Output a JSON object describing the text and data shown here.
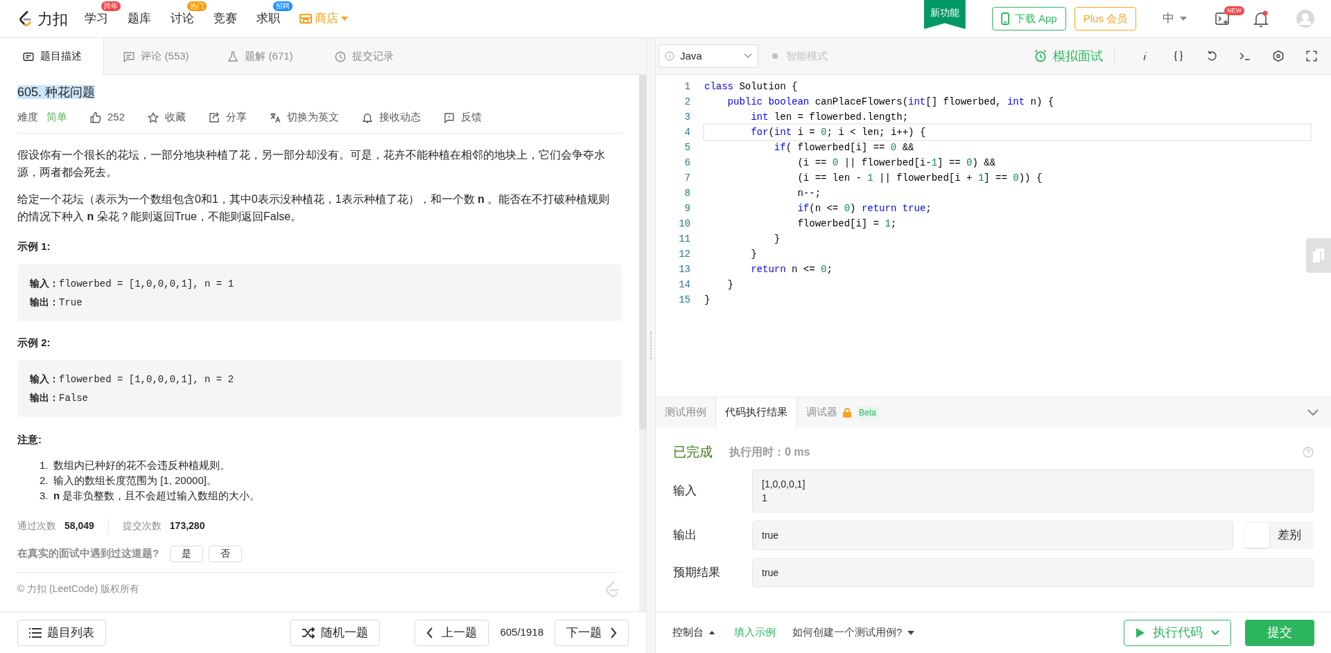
{
  "nav": {
    "logo": "力扣",
    "items": [
      {
        "label": "学习",
        "badge": "跨年",
        "color": "#f5474b"
      },
      {
        "label": "题库"
      },
      {
        "label": "讨论",
        "badge": "热门",
        "color": "#ff9a00"
      },
      {
        "label": "竞赛"
      },
      {
        "label": "求职",
        "badge": "招聘",
        "color": "#1a90ff"
      }
    ],
    "shop": "商店",
    "ribbon": "新功能",
    "download": "下载 App",
    "plus": "Plus 会员",
    "lang": "中",
    "new_badge": "NEW"
  },
  "tabs": [
    {
      "label": "题目描述",
      "selected": true
    },
    {
      "label": "评论 (553)",
      "selected": false
    },
    {
      "label": "题解 (671)",
      "selected": false
    },
    {
      "label": "提交记录",
      "selected": false
    }
  ],
  "editor_bar": {
    "language": "Java",
    "smart_mode": {
      "label": "智能模式",
      "on": false
    },
    "interview": "模拟面试"
  },
  "problem": {
    "title": "605. 种花问题",
    "difficulty_label": "难度",
    "difficulty": "简单",
    "likes": "252",
    "actions": [
      "收藏",
      "分享",
      "切换为英文",
      "接收动态",
      "反馈"
    ],
    "paragraphs": [
      "假设你有一个很长的花坛，一部分地块种植了花，另一部分却没有。可是，花卉不能种植在相邻的地块上，它们会争夺水源，两者都会死去。",
      "给定一个花坛（表示为一个数组包含0和1，其中0表示没种植花，1表示种植了花），和一个数 **n** 。能否在不打破种植规则的情况下种入 **n** 朵花？能则返回True，不能则返回False。"
    ],
    "examples": [
      {
        "heading": "示例 1:",
        "input_label": "输入：",
        "input": "flowerbed = [1,0,0,0,1], n = 1",
        "output_label": "输出：",
        "output": "True"
      },
      {
        "heading": "示例 2:",
        "input_label": "输入：",
        "input": "flowerbed = [1,0,0,0,1], n = 2",
        "output_label": "输出：",
        "output": "False"
      }
    ],
    "notes_heading": "注意:",
    "notes": [
      {
        "number": "1.",
        "text": "数组内已种好的花不会违反种植规则。"
      },
      {
        "number": "2.",
        "text": "输入的数组长度范围为 [1, 20000]。"
      },
      {
        "number": "3.",
        "text": "**n** 是非负整数，且不会超过输入数组的大小。"
      }
    ],
    "stats": [
      {
        "label": "通过次数",
        "value": "58,049"
      },
      {
        "label": "提交次数",
        "value": "173,280"
      }
    ],
    "interview_q": "在真实的面试中遇到过这道题?",
    "answers": [
      "是",
      "否"
    ],
    "copyright": "© 力扣 (LeetCode) 版权所有"
  },
  "left_footer": {
    "list": "题目列表",
    "random": "随机一题",
    "prev": "上一题",
    "position": "605/1918",
    "next": "下一题"
  },
  "code": [
    {
      "number": "1",
      "tokens": [
        {
          "kind": "keyword",
          "text": "class"
        },
        {
          "kind": "plain",
          "text": " Solution {"
        }
      ]
    },
    {
      "number": "2",
      "tokens": [
        {
          "kind": "keyword",
          "text": "    public"
        },
        {
          "kind": "keyword",
          "text": " boolean"
        },
        {
          "kind": "plain",
          "text": " canPlaceFlowers("
        },
        {
          "kind": "keyword",
          "text": "int"
        },
        {
          "kind": "plain",
          "text": "[] flowerbed, "
        },
        {
          "kind": "keyword",
          "text": "int"
        },
        {
          "kind": "plain",
          "text": " n) {"
        }
      ]
    },
    {
      "number": "3",
      "tokens": [
        {
          "kind": "keyword",
          "text": "        int"
        },
        {
          "kind": "plain",
          "text": " len = flowerbed.length;"
        }
      ]
    },
    {
      "number": "4",
      "current": true,
      "tokens": [
        {
          "kind": "keyword",
          "text": "        for"
        },
        {
          "kind": "plain",
          "text": "("
        },
        {
          "kind": "keyword",
          "text": "int"
        },
        {
          "kind": "plain",
          "text": " i = "
        },
        {
          "kind": "number",
          "text": "0"
        },
        {
          "kind": "plain",
          "text": "; i < len; i++) {"
        }
      ]
    },
    {
      "number": "5",
      "tokens": [
        {
          "kind": "keyword",
          "text": "            if"
        },
        {
          "kind": "plain",
          "text": "( flowerbed[i] == "
        },
        {
          "kind": "number",
          "text": "0"
        },
        {
          "kind": "plain",
          "text": " &&"
        }
      ]
    },
    {
      "number": "6",
      "tokens": [
        {
          "kind": "plain",
          "text": "                (i == "
        },
        {
          "kind": "number",
          "text": "0"
        },
        {
          "kind": "plain",
          "text": " || flowerbed[i-"
        },
        {
          "kind": "number",
          "text": "1"
        },
        {
          "kind": "plain",
          "text": "] == "
        },
        {
          "kind": "number",
          "text": "0"
        },
        {
          "kind": "plain",
          "text": ") &&"
        }
      ]
    },
    {
      "number": "7",
      "tokens": [
        {
          "kind": "plain",
          "text": "                (i == len - "
        },
        {
          "kind": "number",
          "text": "1"
        },
        {
          "kind": "plain",
          "text": " || flowerbed[i + "
        },
        {
          "kind": "number",
          "text": "1"
        },
        {
          "kind": "plain",
          "text": "] == "
        },
        {
          "kind": "number",
          "text": "0"
        },
        {
          "kind": "plain",
          "text": ")) {"
        }
      ]
    },
    {
      "number": "8",
      "tokens": [
        {
          "kind": "plain",
          "text": "                n--;"
        }
      ]
    },
    {
      "number": "9",
      "tokens": [
        {
          "kind": "keyword",
          "text": "                if"
        },
        {
          "kind": "plain",
          "text": "(n <= "
        },
        {
          "kind": "number",
          "text": "0"
        },
        {
          "kind": "plain",
          "text": ") "
        },
        {
          "kind": "keyword",
          "text": "return"
        },
        {
          "kind": "keyword",
          "text": " true"
        },
        {
          "kind": "plain",
          "text": ";"
        }
      ]
    },
    {
      "number": "10",
      "tokens": [
        {
          "kind": "plain",
          "text": "                flowerbed[i] = "
        },
        {
          "kind": "number",
          "text": "1"
        },
        {
          "kind": "plain",
          "text": ";"
        }
      ]
    },
    {
      "number": "11",
      "tokens": [
        {
          "kind": "plain",
          "text": "            }"
        }
      ]
    },
    {
      "number": "12",
      "tokens": [
        {
          "kind": "plain",
          "text": "        }"
        }
      ]
    },
    {
      "number": "13",
      "tokens": [
        {
          "kind": "keyword",
          "text": "        return"
        },
        {
          "kind": "plain",
          "text": " n <= "
        },
        {
          "kind": "number",
          "text": "0"
        },
        {
          "kind": "plain",
          "text": ";"
        }
      ]
    },
    {
      "number": "14",
      "tokens": [
        {
          "kind": "plain",
          "text": "    }"
        }
      ]
    },
    {
      "number": "15",
      "tokens": [
        {
          "kind": "plain",
          "text": "}"
        }
      ]
    }
  ],
  "result_tabs": [
    {
      "label": "测试用例",
      "selected": false
    },
    {
      "label": "代码执行结果",
      "selected": true
    },
    {
      "label": "调试器",
      "selected": false,
      "beta": "Beta"
    }
  ],
  "result": {
    "status": "已完成",
    "time": "执行用时：0 ms",
    "rows": [
      {
        "label": "输入",
        "lines": [
          "[1,0,0,0,1]",
          "1"
        ]
      },
      {
        "label": "输出",
        "lines": [
          "true"
        ],
        "diff": {
          "label": "差别",
          "on": false
        }
      },
      {
        "label": "预期结果",
        "lines": [
          "true"
        ]
      }
    ]
  },
  "right_footer": {
    "console": "控制台",
    "fill": "填入示例",
    "howto": "如何创建一个测试用例?",
    "run": "执行代码",
    "submit": "提交"
  }
}
